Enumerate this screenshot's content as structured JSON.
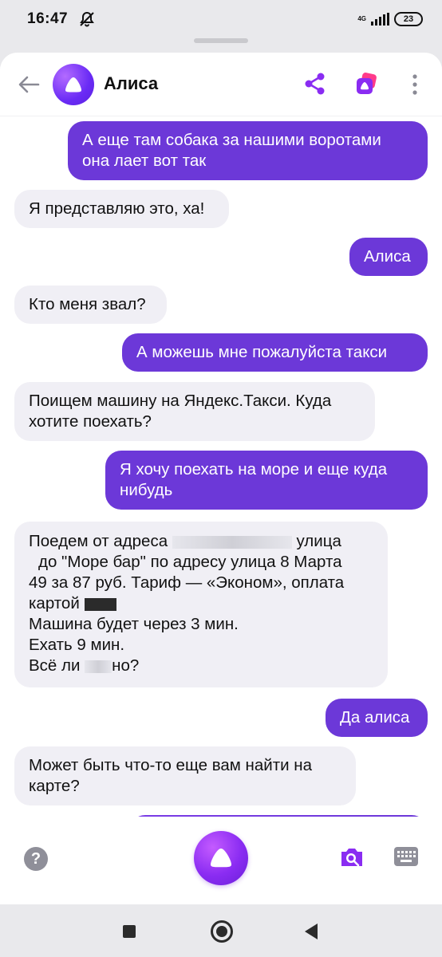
{
  "status": {
    "time": "16:47",
    "network": "4G",
    "battery": "23"
  },
  "header": {
    "title": "Алиса"
  },
  "messages": [
    {
      "from": "user",
      "lines": [
        "А еще там собака за нашими воротами",
        "она лает вот так"
      ]
    },
    {
      "from": "bot",
      "lines": [
        "Я представляю это, ха!"
      ]
    },
    {
      "from": "user",
      "lines": [
        "Алиса"
      ]
    },
    {
      "from": "bot",
      "lines": [
        "Кто меня звал?"
      ]
    },
    {
      "from": "user",
      "lines": [
        "А можешь мне пожалуйста такси"
      ]
    },
    {
      "from": "bot",
      "lines": [
        "Поищем машину на Яндекс.Такси. Куда",
        "хотите поехать?"
      ]
    },
    {
      "from": "user",
      "lines": [
        "Я хочу поехать на море и еще куда",
        "нибудь"
      ]
    },
    {
      "from": "bot",
      "lines": [
        "Поедем от адреса",
        "улица",
        "до \"Море бар\" по адресу улица 8 Марта",
        "49 за 87 руб. Тариф — «Эконом», оплата",
        "картой",
        "Машина будет через 3 мин.",
        "Ехать 9 мин.",
        "Всё ли",
        "но?"
      ]
    },
    {
      "from": "user",
      "lines": [
        "Да алиса"
      ]
    },
    {
      "from": "bot",
      "lines": [
        "Может быть что-то еще вам найти на",
        "карте?"
      ]
    }
  ],
  "colors": {
    "accent": "#6c38d8",
    "bot_bubble": "#f0eff5",
    "alice": "#8a2cf2"
  },
  "icons": {
    "back": "arrow-left-icon",
    "share": "share-icon",
    "skills": "skills-icon",
    "more": "more-vertical-icon",
    "help": "help-icon",
    "camera": "camera-search-icon",
    "keyboard": "keyboard-icon",
    "alice": "alice-logo-icon"
  },
  "bottom": {
    "help_label": "?"
  }
}
